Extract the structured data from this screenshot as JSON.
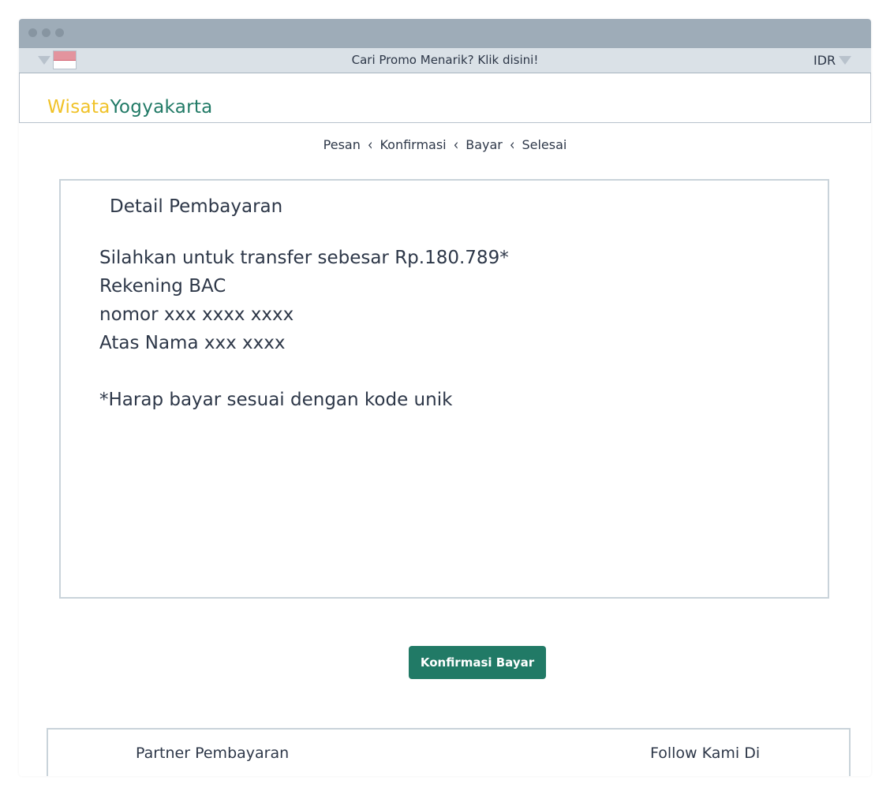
{
  "topbar": {
    "promo_text": "Cari Promo Menarik? Klik disini!",
    "currency": "IDR"
  },
  "logo": {
    "part1": "Wisata",
    "part2": "Yogyakarta"
  },
  "breadcrumb": [
    "Pesan",
    "Konfirmasi",
    "Bayar",
    "Selesai"
  ],
  "payment": {
    "title": "Detail Pembayaran",
    "lines": [
      "Silahkan untuk transfer sebesar Rp.180.789*",
      "Rekening BAC",
      "nomor xxx xxxx xxxx",
      "Atas Nama xxx xxxx"
    ],
    "note": "*Harap bayar sesuai dengan kode unik"
  },
  "confirm_button": "Konfirmasi Bayar",
  "footer": {
    "left": "Partner Pembayaran",
    "right": "Follow Kami Di"
  },
  "colors": {
    "brand_green": "#217a66",
    "brand_yellow": "#f0c228",
    "titlebar": "#9eacb8"
  },
  "icons": [
    "window-dot-icon",
    "dropdown-caret-icon",
    "indonesia-flag-icon",
    "chevron-left-icon"
  ]
}
